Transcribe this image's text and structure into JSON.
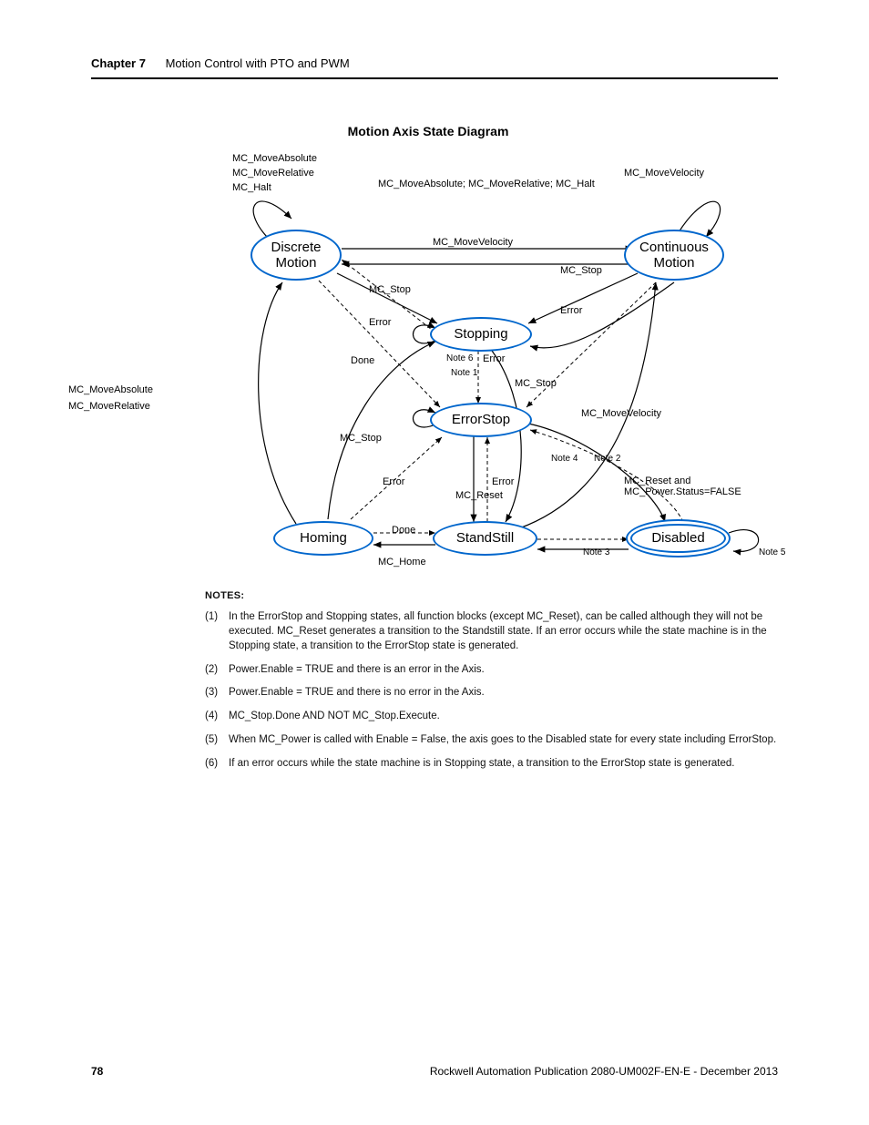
{
  "header": {
    "chapter": "Chapter 7",
    "chapter_title": "Motion Control with PTO and PWM"
  },
  "diagram": {
    "title": "Motion Axis State Diagram",
    "states": {
      "discrete": "Discrete\nMotion",
      "continuous": "Continuous\nMotion",
      "stopping": "Stopping",
      "errorstop": "ErrorStop",
      "homing": "Homing",
      "standstill": "StandStill",
      "disabled": "Disabled"
    },
    "labels": {
      "discrete_self1": "MC_MoveAbsolute",
      "discrete_self2": "MC_MoveRelative",
      "discrete_self3": "MC_Halt",
      "top_center": "MC_MoveAbsolute; MC_MoveRelative; MC_Halt",
      "cont_self": "MC_MoveVelocity",
      "dc_to_cm": "MC_MoveVelocity",
      "mc_stop1": "MC_Stop",
      "mc_stop_left": "MC_Stop",
      "error1": "Error",
      "error2": "Error",
      "note6": "Note 6",
      "error_center": "Error",
      "note1": "Note 1",
      "done1": "Done",
      "homing_side1": "MC_MoveAbsolute",
      "homing_side2": "MC_MoveRelative",
      "mc_stop2": "MC_Stop",
      "mc_movevel2": "MC_MoveVelocity",
      "note4": "Note 4",
      "note2": "Note 2",
      "mc_stop3": "MC_Stop",
      "error3": "Error",
      "error4": "Error",
      "mc_reset": "MC_Reset",
      "mc_reset_power": "MC_Reset and\nMC_Power.Status=FALSE",
      "done2": "Done",
      "mc_home": "MC_Home",
      "note3": "Note 3",
      "note5": "Note 5"
    }
  },
  "notes": {
    "heading": "NOTES:",
    "items": [
      "In the ErrorStop and Stopping states, all function blocks (except MC_Reset), can be called although they will not be executed. MC_Reset  generates a transition to the Standstill state. If an error occurs while the state machine is in the Stopping state, a transition to the ErrorStop state is generated.",
      "Power.Enable = TRUE and there is an error in the Axis.",
      "Power.Enable = TRUE and there is no error in the Axis.",
      "MC_Stop.Done AND NOT MC_Stop.Execute.",
      "When MC_Power is called with Enable = False, the axis goes to the Disabled state for every state including ErrorStop.",
      "If an error occurs while the state machine is in Stopping state, a transition to the ErrorStop state is generated."
    ]
  },
  "footer": {
    "page": "78",
    "pub": "Rockwell Automation Publication 2080-UM002F-EN-E - December 2013"
  }
}
